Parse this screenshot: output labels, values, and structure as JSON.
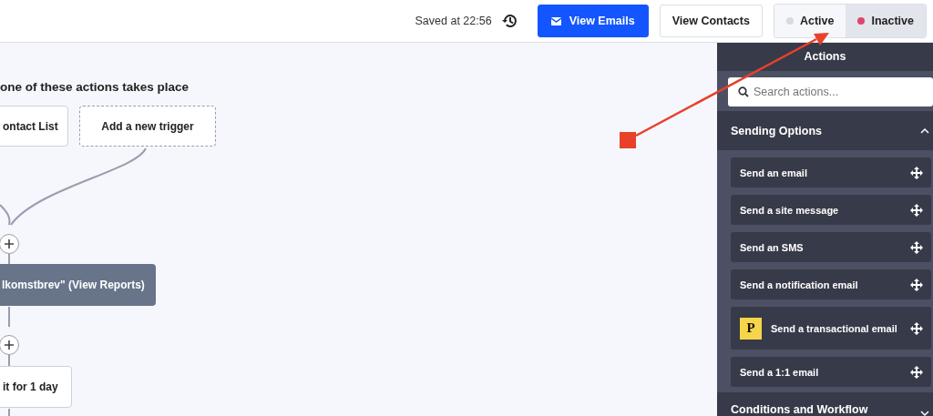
{
  "header": {
    "saved_text": "Saved at 22:56",
    "buttons": [
      {
        "label": "View Emails",
        "kind": "primary"
      },
      {
        "label": "View Contacts",
        "kind": "secondary"
      }
    ],
    "status_toggle": [
      {
        "label": "Active",
        "selected": false,
        "color": "#d9dae0"
      },
      {
        "label": "Inactive",
        "selected": true,
        "color": "#e0456b"
      }
    ]
  },
  "canvas": {
    "heading": "one of these actions takes place",
    "triggers": [
      {
        "label": "ontact List",
        "kind": "trigger"
      },
      {
        "label": "Add a new trigger",
        "kind": "add"
      }
    ],
    "steps": [
      {
        "label": "lkomstbrev\" (View Reports)",
        "kind": "email"
      },
      {
        "label": "it for 1 day",
        "kind": "wait"
      }
    ]
  },
  "sidebar": {
    "title": "Actions",
    "search": {
      "placeholder": "Search actions..."
    },
    "sections": [
      {
        "title": "Sending Options",
        "expanded": true,
        "items": [
          {
            "label": "Send an email",
            "kind": "plain"
          },
          {
            "label": "Send a site message",
            "kind": "plain"
          },
          {
            "label": "Send an SMS",
            "kind": "plain"
          },
          {
            "label": "Send a notification email",
            "kind": "plain"
          },
          {
            "label": "Send a transactional email",
            "kind": "postmark",
            "badge": "P"
          },
          {
            "label": "Send a 1:1 email",
            "kind": "plain"
          }
        ]
      },
      {
        "title": "Conditions and Workflow",
        "expanded": false
      }
    ]
  }
}
